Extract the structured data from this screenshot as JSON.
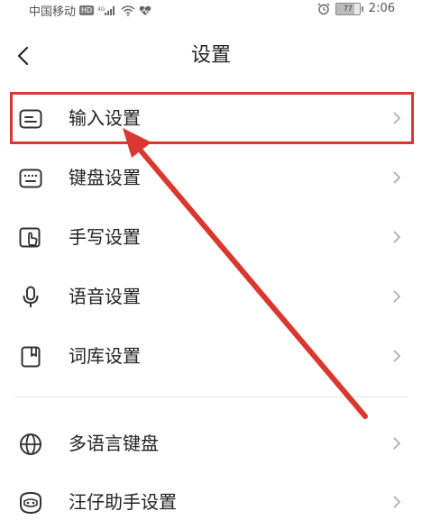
{
  "status_bar": {
    "carrier": "中国移动",
    "network_badge": "HD",
    "signal_label": "4G",
    "time": "2:06",
    "battery_level": "77",
    "battery_fraction": 0.77,
    "icons": [
      "hd-icon",
      "signal-icon",
      "wifi-icon",
      "heart-icon",
      "alarm-icon",
      "battery-icon"
    ]
  },
  "header": {
    "title": "设置",
    "back_icon": "chevron-left-icon"
  },
  "settings": {
    "items": [
      {
        "label": "输入设置",
        "icon": "input-box-icon"
      },
      {
        "label": "键盘设置",
        "icon": "keyboard-icon"
      },
      {
        "label": "手写设置",
        "icon": "handwriting-icon"
      },
      {
        "label": "语音设置",
        "icon": "microphone-icon"
      },
      {
        "label": "词库设置",
        "icon": "dictionary-icon"
      }
    ],
    "more_items": [
      {
        "label": "多语言键盘",
        "icon": "globe-icon"
      },
      {
        "label": "汪仔助手设置",
        "icon": "assistant-icon"
      }
    ]
  },
  "annotation": {
    "highlight_color": "#d9372f",
    "arrow_color": "#d9372f"
  }
}
